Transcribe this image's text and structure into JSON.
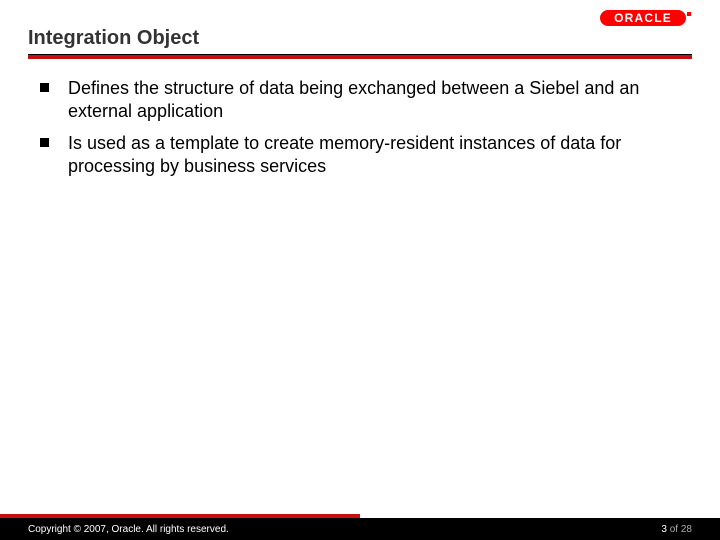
{
  "brand": {
    "name": "ORACLE",
    "color": "#ff0000"
  },
  "slide": {
    "title": "Integration Object",
    "bullets": [
      "Defines the structure of data being exchanged between a Siebel and an external application",
      "Is used as a template to create memory-resident instances of data for processing by business services"
    ]
  },
  "footer": {
    "copyright": "Copyright © 2007, Oracle. All rights reserved.",
    "page_current": "3",
    "page_sep": " of ",
    "page_total": "28"
  }
}
